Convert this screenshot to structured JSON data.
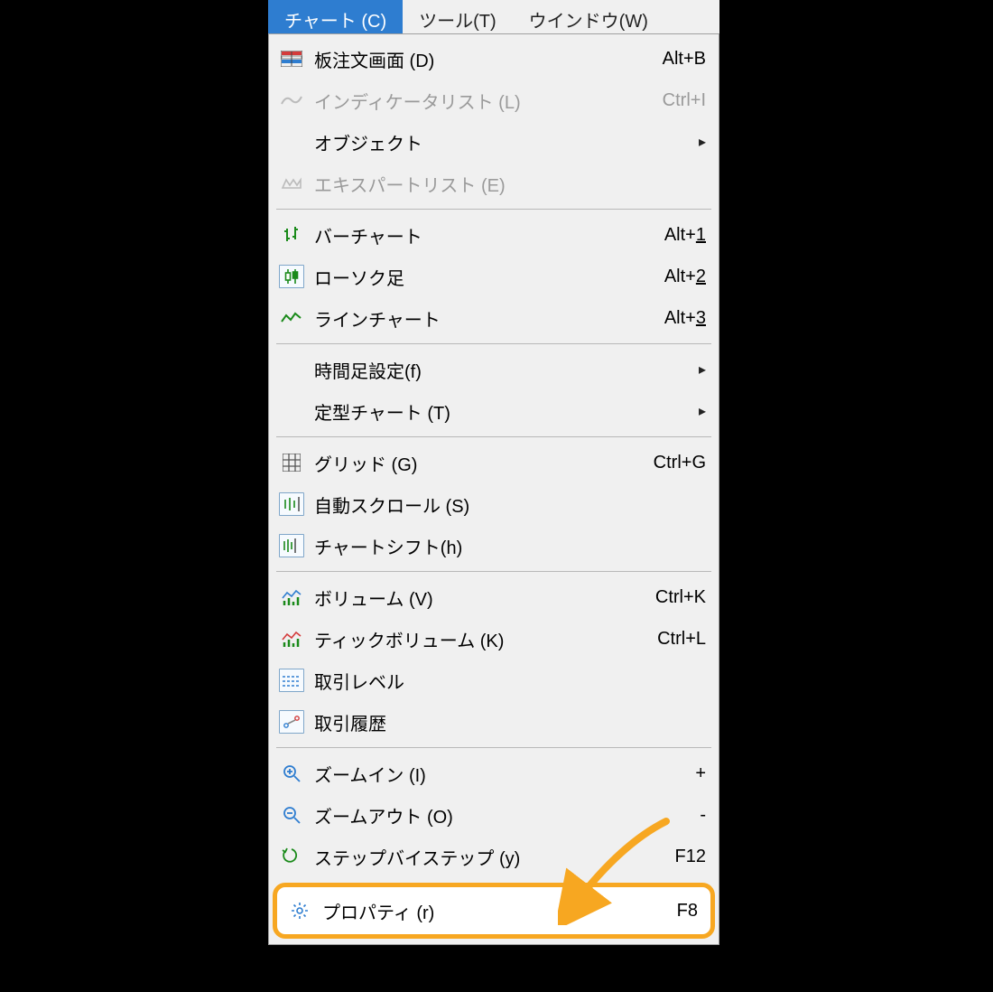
{
  "menubar": {
    "chart": "チャート (C)",
    "tools": "ツール(T)",
    "window": "ウインドウ(W)"
  },
  "menu": {
    "depth": {
      "label": "板注文画面 (D)",
      "shortcut": "Alt+B"
    },
    "indicators": {
      "label": "インディケータリスト (L)",
      "shortcut": "Ctrl+I"
    },
    "objects": {
      "label": "オブジェクト"
    },
    "experts": {
      "label": "エキスパートリスト (E)"
    },
    "bar": {
      "label": "バーチャート",
      "prefix": "Alt+",
      "key": "1"
    },
    "candle": {
      "label": "ローソク足",
      "prefix": "Alt+",
      "key": "2"
    },
    "line": {
      "label": "ラインチャート",
      "prefix": "Alt+",
      "key": "3"
    },
    "timeframes": {
      "label": "時間足設定(f)"
    },
    "templates": {
      "label": "定型チャート (T)"
    },
    "grid": {
      "label": "グリッド (G)",
      "shortcut": "Ctrl+G"
    },
    "autoscroll": {
      "label": "自動スクロール (S)"
    },
    "shift": {
      "label": "チャートシフト(h)"
    },
    "volume": {
      "label": "ボリューム (V)",
      "shortcut": "Ctrl+K"
    },
    "tickvolume": {
      "label": "ティックボリューム (K)",
      "shortcut": "Ctrl+L"
    },
    "levels": {
      "label": "取引レベル"
    },
    "history": {
      "label": "取引履歴"
    },
    "zoomin": {
      "label": "ズームイン (I)",
      "shortcut": "+"
    },
    "zoomout": {
      "label": "ズームアウト (O)",
      "shortcut": "-"
    },
    "step": {
      "label": "ステップバイステップ (y)",
      "shortcut": "F12"
    },
    "properties": {
      "label": "プロパティ (r)",
      "shortcut": "F8"
    }
  }
}
